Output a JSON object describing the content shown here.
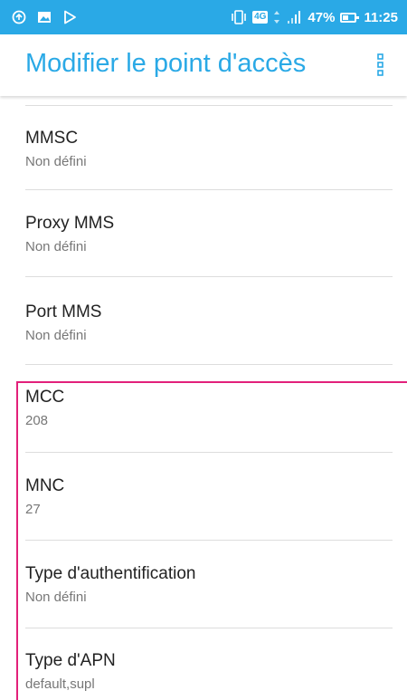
{
  "status_bar": {
    "battery_percent": "47%",
    "battery_level": 0.47,
    "network_type": "4G",
    "time": "11:25",
    "icons": [
      "sync-icon",
      "image-icon",
      "play-store-icon",
      "vibrate-icon",
      "network-4g-icon",
      "data-arrows-icon",
      "signal-icon",
      "battery-icon"
    ]
  },
  "toolbar": {
    "title": "Modifier le point d'accès",
    "menu_icon": "overflow-menu-icon"
  },
  "settings": [
    {
      "title": "MMSC",
      "summary": "Non défini"
    },
    {
      "title": "Proxy MMS",
      "summary": "Non défini"
    },
    {
      "title": "Port MMS",
      "summary": "Non défini"
    },
    {
      "title": "MCC",
      "summary": "208"
    },
    {
      "title": "MNC",
      "summary": "27"
    },
    {
      "title": "Type d'authentification",
      "summary": "Non défini"
    },
    {
      "title": "Type d'APN",
      "summary": "default,supl"
    }
  ],
  "colors": {
    "accent": "#2aa9e6",
    "highlight": "#e2207a"
  }
}
